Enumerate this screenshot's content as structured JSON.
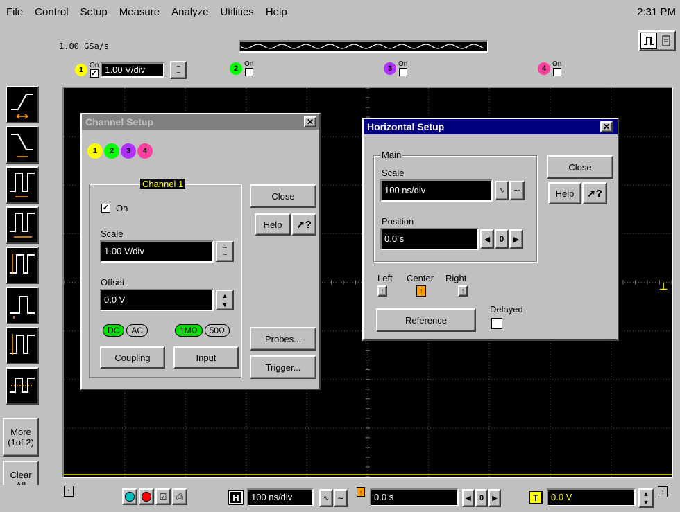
{
  "menubar": {
    "items": [
      "File",
      "Control",
      "Setup",
      "Measure",
      "Analyze",
      "Utilities",
      "Help"
    ],
    "clock": "2:31 PM"
  },
  "acquisition": {
    "sample_rate": "1.00 GSa/s"
  },
  "channels": [
    {
      "num": "1",
      "on_label": "On",
      "enabled": true,
      "scale": "1.00 V/div",
      "color": "#ffff00"
    },
    {
      "num": "2",
      "on_label": "On",
      "enabled": false,
      "color": "#00ff00"
    },
    {
      "num": "3",
      "on_label": "On",
      "enabled": false,
      "color": "#b030ff"
    },
    {
      "num": "4",
      "on_label": "On",
      "enabled": false,
      "color": "#ff40a0"
    }
  ],
  "sidebar": {
    "more_label": "More\n(1of 2)",
    "clear_label": "Clear\nAll"
  },
  "channel_setup": {
    "title": "Channel Setup",
    "channel_tab": "Channel 1",
    "on_label": "On",
    "on_checked": true,
    "scale_label": "Scale",
    "scale_value": "1.00 V/div",
    "offset_label": "Offset",
    "offset_value": "0.0 V",
    "coupling_dc": "DC",
    "coupling_ac": "AC",
    "imp_1m": "1MΩ",
    "imp_50": "50Ω",
    "coupling_button": "Coupling",
    "input_button": "Input",
    "close_button": "Close",
    "help_button": "Help",
    "probes_button": "Probes...",
    "trigger_button": "Trigger..."
  },
  "horizontal_setup": {
    "title": "Horizontal Setup",
    "group_label": "Main",
    "scale_label": "Scale",
    "scale_value": "100 ns/div",
    "position_label": "Position",
    "position_value": "0.0 s",
    "left_label": "Left",
    "center_label": "Center",
    "right_label": "Right",
    "reference_button": "Reference",
    "delayed_label": "Delayed",
    "delayed_checked": false,
    "close_button": "Close",
    "help_button": "Help",
    "zero_label": "0"
  },
  "bottombar": {
    "h_label": "H",
    "timebase": "100 ns/div",
    "position": "0.0 s",
    "zero_label": "0",
    "t_label": "T",
    "trigger_level": "0.0 V"
  },
  "colors": {
    "channel1": "#ffff00",
    "trigger_orange": "#ffa000",
    "dialog_active": "#000080",
    "dialog_inactive": "#808080"
  }
}
